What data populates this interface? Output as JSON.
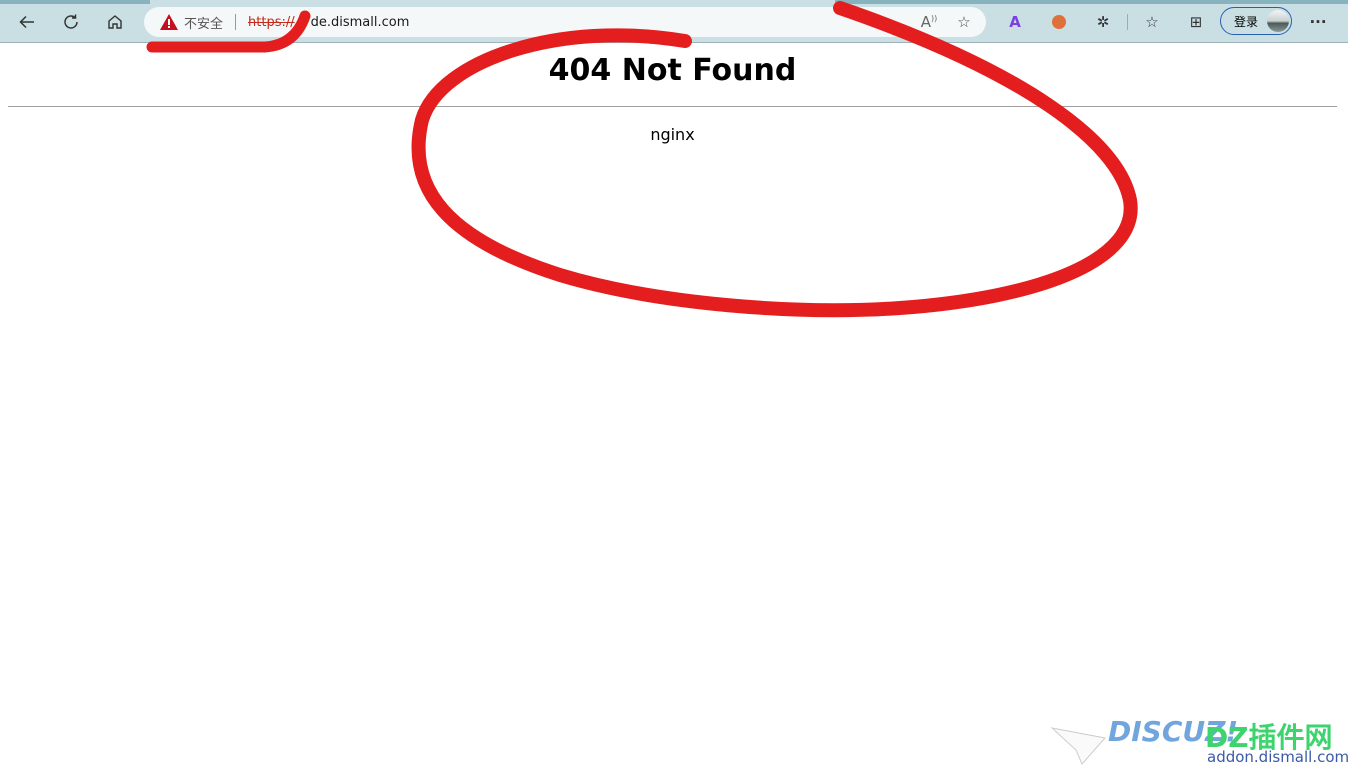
{
  "browser": {
    "nav": {
      "back_icon": "arrow-left",
      "refresh_icon": "refresh",
      "home_icon": "home"
    },
    "address_bar": {
      "security_label": "不安全",
      "url_scheme": "https://",
      "url_host_visible": "de.dismall.com"
    },
    "toolbar": {
      "read_aloud_icon": "read-aloud",
      "favorite_add_icon": "star-plus",
      "translate_icon": "translate",
      "extension_icon": "extension",
      "puzzle_icon": "puzzle",
      "favorites_icon": "star-list",
      "collections_icon": "collections",
      "more_icon": "ellipsis",
      "more_label": "···",
      "login_label": "登录"
    }
  },
  "page": {
    "title": "404 Not Found",
    "server": "nginx"
  },
  "watermark": {
    "brand": "DISCUZ!",
    "cn": "DZ插件网",
    "site": "addon.dismall.com"
  },
  "colors": {
    "annotation": "#e41e1e",
    "toolbar_bg": "#c9dfe3",
    "insecure": "#c42b1c"
  }
}
